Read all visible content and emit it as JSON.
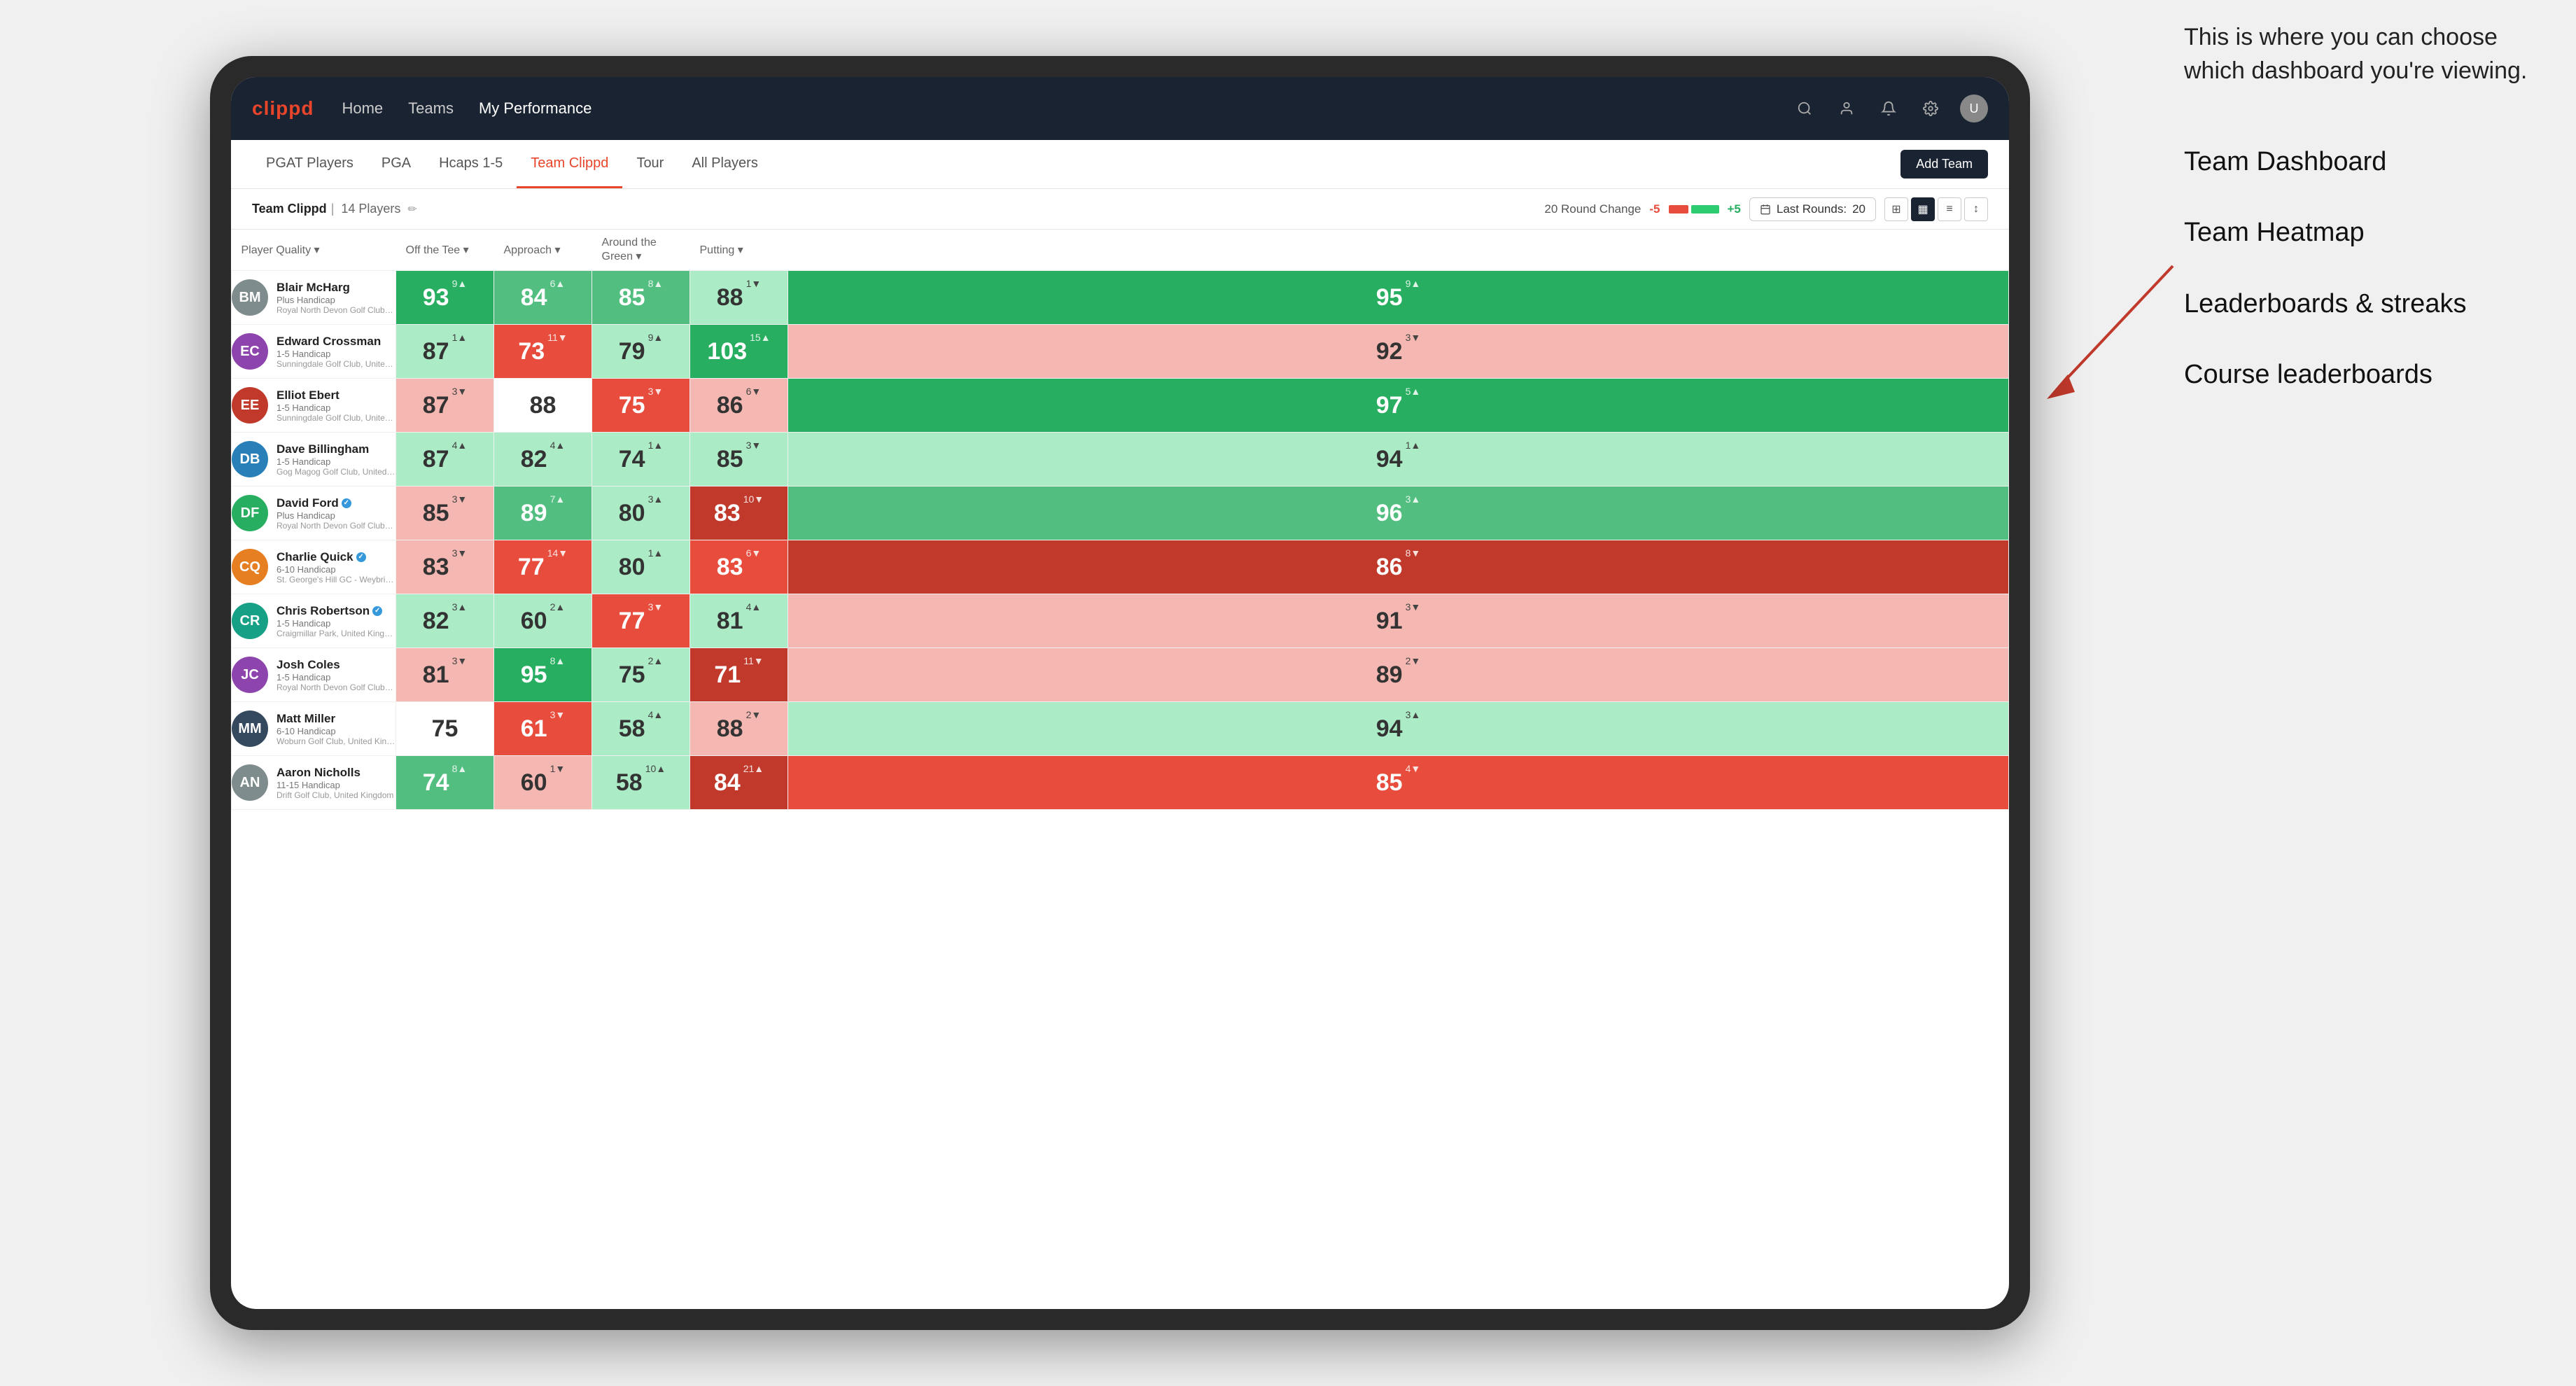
{
  "annotation": {
    "intro_text": "This is where you can choose which dashboard you're viewing.",
    "items": [
      "Team Dashboard",
      "Team Heatmap",
      "Leaderboards & streaks",
      "Course leaderboards"
    ]
  },
  "nav": {
    "logo": "clippd",
    "links": [
      "Home",
      "Teams",
      "My Performance"
    ],
    "active_link": "My Performance"
  },
  "sub_nav": {
    "links": [
      "PGAT Players",
      "PGA",
      "Hcaps 1-5",
      "Team Clippd",
      "Tour",
      "All Players"
    ],
    "active": "Team Clippd",
    "add_btn": "Add Team"
  },
  "team_header": {
    "name": "Team Clippd",
    "separator": "|",
    "count": "14 Players",
    "round_change_label": "20 Round Change",
    "change_neg": "-5",
    "change_pos": "+5",
    "last_rounds_label": "Last Rounds:",
    "last_rounds_val": "20"
  },
  "table": {
    "columns": [
      {
        "key": "player",
        "label": "Player Quality ▾"
      },
      {
        "key": "off_tee",
        "label": "Off the Tee ▾"
      },
      {
        "key": "approach",
        "label": "Approach ▾"
      },
      {
        "key": "around_green",
        "label": "Around the Green ▾"
      },
      {
        "key": "putting",
        "label": "Putting ▾"
      }
    ],
    "rows": [
      {
        "name": "Blair McHarg",
        "handicap": "Plus Handicap",
        "club": "Royal North Devon Golf Club, United Kingdom",
        "avatar_color": "#7f8c8d",
        "avatar_initials": "BM",
        "off_tee": {
          "val": 93,
          "change": "9",
          "dir": "up",
          "bg": "bg-strong-green"
        },
        "approach": {
          "val": 84,
          "change": "6",
          "dir": "up",
          "bg": "bg-medium-green"
        },
        "around_green": {
          "val": 85,
          "change": "8",
          "dir": "up",
          "bg": "bg-medium-green"
        },
        "atg": {
          "val": 88,
          "change": "1",
          "dir": "down",
          "bg": "bg-light-green"
        },
        "putting": {
          "val": 95,
          "change": "9",
          "dir": "up",
          "bg": "bg-strong-green"
        }
      },
      {
        "name": "Edward Crossman",
        "handicap": "1-5 Handicap",
        "club": "Sunningdale Golf Club, United Kingdom",
        "avatar_color": "#8e44ad",
        "avatar_initials": "EC",
        "off_tee": {
          "val": 87,
          "change": "1",
          "dir": "up",
          "bg": "bg-light-green"
        },
        "approach": {
          "val": 73,
          "change": "11",
          "dir": "down",
          "bg": "bg-medium-red"
        },
        "around_green": {
          "val": 79,
          "change": "9",
          "dir": "up",
          "bg": "bg-light-green"
        },
        "atg": {
          "val": 103,
          "change": "15",
          "dir": "up",
          "bg": "bg-strong-green"
        },
        "putting": {
          "val": 92,
          "change": "3",
          "dir": "down",
          "bg": "bg-light-red"
        }
      },
      {
        "name": "Elliot Ebert",
        "handicap": "1-5 Handicap",
        "club": "Sunningdale Golf Club, United Kingdom",
        "avatar_color": "#c0392b",
        "avatar_initials": "EE",
        "off_tee": {
          "val": 87,
          "change": "3",
          "dir": "down",
          "bg": "bg-light-red"
        },
        "approach": {
          "val": 88,
          "change": "",
          "dir": "",
          "bg": "bg-white"
        },
        "around_green": {
          "val": 75,
          "change": "3",
          "dir": "down",
          "bg": "bg-medium-red"
        },
        "atg": {
          "val": 86,
          "change": "6",
          "dir": "down",
          "bg": "bg-light-red"
        },
        "putting": {
          "val": 97,
          "change": "5",
          "dir": "up",
          "bg": "bg-strong-green"
        }
      },
      {
        "name": "Dave Billingham",
        "handicap": "1-5 Handicap",
        "club": "Gog Magog Golf Club, United Kingdom",
        "avatar_color": "#2980b9",
        "avatar_initials": "DB",
        "off_tee": {
          "val": 87,
          "change": "4",
          "dir": "up",
          "bg": "bg-light-green"
        },
        "approach": {
          "val": 82,
          "change": "4",
          "dir": "up",
          "bg": "bg-light-green"
        },
        "around_green": {
          "val": 74,
          "change": "1",
          "dir": "up",
          "bg": "bg-light-green"
        },
        "atg": {
          "val": 85,
          "change": "3",
          "dir": "down",
          "bg": "bg-light-green"
        },
        "putting": {
          "val": 94,
          "change": "1",
          "dir": "up",
          "bg": "bg-light-green"
        }
      },
      {
        "name": "David Ford",
        "handicap": "Plus Handicap",
        "club": "Royal North Devon Golf Club, United Kingdom",
        "avatar_color": "#27ae60",
        "avatar_initials": "DF",
        "verified": true,
        "off_tee": {
          "val": 85,
          "change": "3",
          "dir": "down",
          "bg": "bg-light-red"
        },
        "approach": {
          "val": 89,
          "change": "7",
          "dir": "up",
          "bg": "bg-medium-green"
        },
        "around_green": {
          "val": 80,
          "change": "3",
          "dir": "up",
          "bg": "bg-light-green"
        },
        "atg": {
          "val": 83,
          "change": "10",
          "dir": "down",
          "bg": "bg-strong-red"
        },
        "putting": {
          "val": 96,
          "change": "3",
          "dir": "up",
          "bg": "bg-medium-green"
        }
      },
      {
        "name": "Charlie Quick",
        "handicap": "6-10 Handicap",
        "club": "St. George's Hill GC - Weybridge - Surrey, Uni...",
        "avatar_color": "#e67e22",
        "avatar_initials": "CQ",
        "verified": true,
        "off_tee": {
          "val": 83,
          "change": "3",
          "dir": "down",
          "bg": "bg-light-red"
        },
        "approach": {
          "val": 77,
          "change": "14",
          "dir": "down",
          "bg": "bg-medium-red"
        },
        "around_green": {
          "val": 80,
          "change": "1",
          "dir": "up",
          "bg": "bg-light-green"
        },
        "atg": {
          "val": 83,
          "change": "6",
          "dir": "down",
          "bg": "bg-medium-red"
        },
        "putting": {
          "val": 86,
          "change": "8",
          "dir": "down",
          "bg": "bg-strong-red"
        }
      },
      {
        "name": "Chris Robertson",
        "handicap": "1-5 Handicap",
        "club": "Craigmillar Park, United Kingdom",
        "avatar_color": "#16a085",
        "avatar_initials": "CR",
        "verified": true,
        "off_tee": {
          "val": 82,
          "change": "3",
          "dir": "up",
          "bg": "bg-light-green"
        },
        "approach": {
          "val": 60,
          "change": "2",
          "dir": "up",
          "bg": "bg-light-green"
        },
        "around_green": {
          "val": 77,
          "change": "3",
          "dir": "down",
          "bg": "bg-medium-red"
        },
        "atg": {
          "val": 81,
          "change": "4",
          "dir": "up",
          "bg": "bg-light-green"
        },
        "putting": {
          "val": 91,
          "change": "3",
          "dir": "down",
          "bg": "bg-light-red"
        }
      },
      {
        "name": "Josh Coles",
        "handicap": "1-5 Handicap",
        "club": "Royal North Devon Golf Club, United Kingdom",
        "avatar_color": "#8e44ad",
        "avatar_initials": "JC",
        "off_tee": {
          "val": 81,
          "change": "3",
          "dir": "down",
          "bg": "bg-light-red"
        },
        "approach": {
          "val": 95,
          "change": "8",
          "dir": "up",
          "bg": "bg-strong-green"
        },
        "around_green": {
          "val": 75,
          "change": "2",
          "dir": "up",
          "bg": "bg-light-green"
        },
        "atg": {
          "val": 71,
          "change": "11",
          "dir": "down",
          "bg": "bg-strong-red"
        },
        "putting": {
          "val": 89,
          "change": "2",
          "dir": "down",
          "bg": "bg-light-red"
        }
      },
      {
        "name": "Matt Miller",
        "handicap": "6-10 Handicap",
        "club": "Woburn Golf Club, United Kingdom",
        "avatar_color": "#34495e",
        "avatar_initials": "MM",
        "off_tee": {
          "val": 75,
          "change": "",
          "dir": "",
          "bg": "bg-white"
        },
        "approach": {
          "val": 61,
          "change": "3",
          "dir": "down",
          "bg": "bg-medium-red"
        },
        "around_green": {
          "val": 58,
          "change": "4",
          "dir": "up",
          "bg": "bg-light-green"
        },
        "atg": {
          "val": 88,
          "change": "2",
          "dir": "down",
          "bg": "bg-light-red"
        },
        "putting": {
          "val": 94,
          "change": "3",
          "dir": "up",
          "bg": "bg-light-green"
        }
      },
      {
        "name": "Aaron Nicholls",
        "handicap": "11-15 Handicap",
        "club": "Drift Golf Club, United Kingdom",
        "avatar_color": "#7f8c8d",
        "avatar_initials": "AN",
        "off_tee": {
          "val": 74,
          "change": "8",
          "dir": "up",
          "bg": "bg-medium-green"
        },
        "approach": {
          "val": 60,
          "change": "1",
          "dir": "down",
          "bg": "bg-light-red"
        },
        "around_green": {
          "val": 58,
          "change": "10",
          "dir": "up",
          "bg": "bg-light-green"
        },
        "atg": {
          "val": 84,
          "change": "21",
          "dir": "up",
          "bg": "bg-strong-red"
        },
        "putting": {
          "val": 85,
          "change": "4",
          "dir": "down",
          "bg": "bg-medium-red"
        }
      }
    ]
  }
}
